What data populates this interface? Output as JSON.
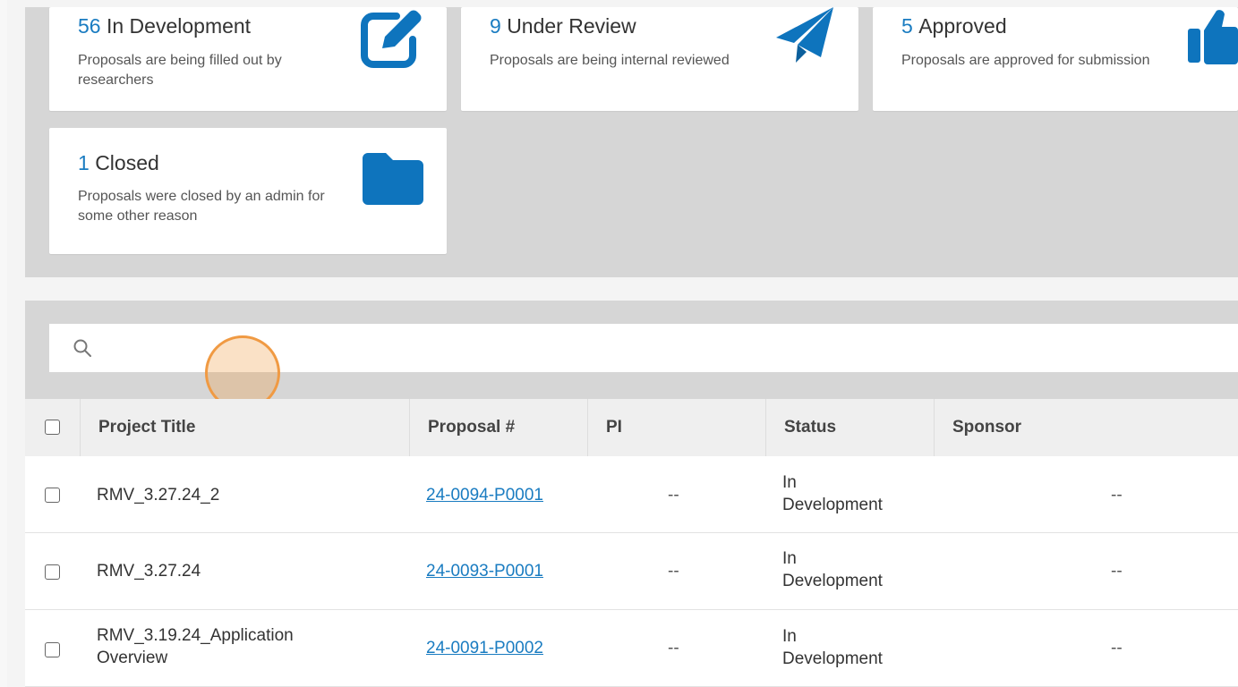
{
  "colors": {
    "accent": "#1a7cc1",
    "icon": "#0e74bd",
    "panel": "#d6d6d6",
    "cursor": "#f09a43"
  },
  "status_cards": [
    {
      "count": "56",
      "label": "In Development",
      "description": "Proposals are being filled out by researchers",
      "icon": "edit-icon"
    },
    {
      "count": "9",
      "label": "Under Review",
      "description": "Proposals are being internal reviewed",
      "icon": "paper-plane-icon"
    },
    {
      "count": "5",
      "label": "Approved",
      "description": "Proposals are approved for submission",
      "icon": "thumbs-up-icon"
    },
    {
      "count": "1",
      "label": "Closed",
      "description": "Proposals were closed by an admin for some other reason",
      "icon": "folder-icon"
    }
  ],
  "search": {
    "value": "",
    "icon": "search-icon"
  },
  "table": {
    "headers": {
      "title": "Project Title",
      "proposal": "Proposal #",
      "pi": "PI",
      "status": "Status",
      "sponsor": "Sponsor"
    },
    "rows": [
      {
        "title": "RMV_3.27.24_2",
        "proposal": "24-0094-P0001",
        "pi": "--",
        "status_line1": "In",
        "status_line2": "Development",
        "sponsor": "--"
      },
      {
        "title": "RMV_3.27.24",
        "proposal": "24-0093-P0001",
        "pi": "--",
        "status_line1": "In",
        "status_line2": "Development",
        "sponsor": "--"
      },
      {
        "title_line1": "RMV_3.19.24_Application",
        "title_line2": "Overview",
        "proposal": "24-0091-P0002",
        "pi": "--",
        "status_line1": "In",
        "status_line2": "Development",
        "sponsor": "--"
      }
    ]
  }
}
